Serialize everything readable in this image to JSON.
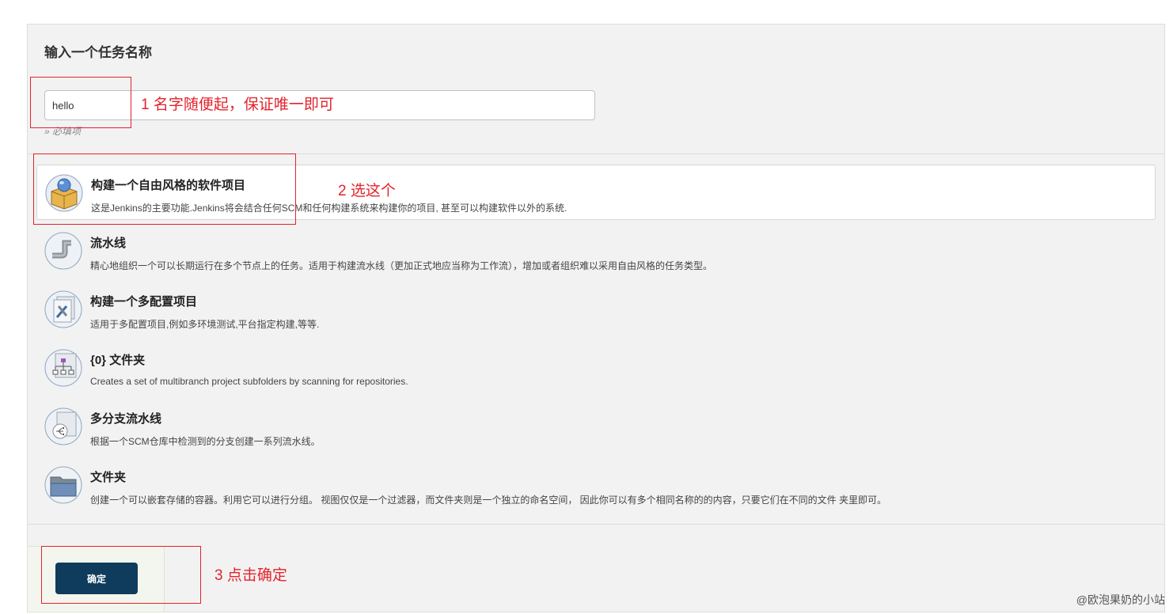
{
  "form": {
    "section_title": "输入一个任务名称",
    "name_value": "hello",
    "required_note": "» 必填项"
  },
  "items": [
    {
      "title": "构建一个自由风格的软件项目",
      "desc": "这是Jenkins的主要功能.Jenkins将会结合任何SCM和任何构建系统来构建你的项目, 甚至可以构建软件以外的系统.",
      "icon": "freestyle-project-icon",
      "selected": true
    },
    {
      "title": "流水线",
      "desc": "精心地组织一个可以长期运行在多个节点上的任务。适用于构建流水线（更加正式地应当称为工作流），增加或者组织难以采用自由风格的任务类型。",
      "icon": "pipeline-icon",
      "selected": false
    },
    {
      "title": "构建一个多配置项目",
      "desc": "适用于多配置项目,例如多环境测试,平台指定构建,等等.",
      "icon": "multi-config-icon",
      "selected": false
    },
    {
      "title": "{0} 文件夹",
      "desc": "Creates a set of multibranch project subfolders by scanning for repositories.",
      "icon": "org-folder-icon",
      "selected": false
    },
    {
      "title": "多分支流水线",
      "desc": "根据一个SCM仓库中检测到的分支创建一系列流水线。",
      "icon": "multibranch-pipeline-icon",
      "selected": false
    },
    {
      "title": "文件夹",
      "desc": "创建一个可以嵌套存储的容器。利用它可以进行分组。 视图仅仅是一个过滤器，而文件夹则是一个独立的命名空间， 因此你可以有多个相同名称的的内容，只要它们在不同的文件 夹里即可。",
      "icon": "folder-icon",
      "selected": false
    }
  ],
  "footer": {
    "ok_label": "确定"
  },
  "annotations": {
    "note1": "1 名字随便起，保证唯一即可",
    "note2": "2 选这个",
    "note3": "3 点击确定"
  },
  "watermark": "@欧泡果奶的小站",
  "colors": {
    "annotation": "#e3232c",
    "button": "#0f3b5c",
    "panel": "#f2f2f2"
  }
}
